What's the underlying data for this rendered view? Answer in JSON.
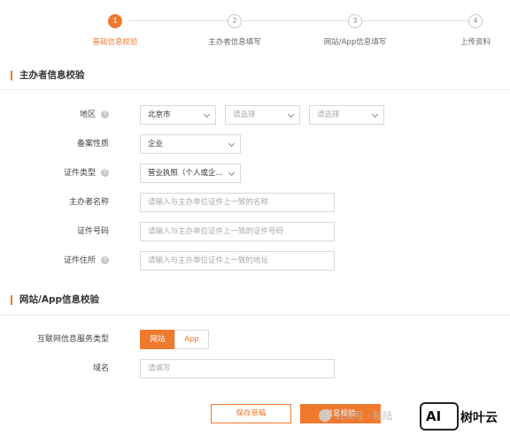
{
  "steps": [
    {
      "num": "1",
      "label": "基础信息校验",
      "active": true
    },
    {
      "num": "2",
      "label": "主办者信息填写",
      "active": false
    },
    {
      "num": "3",
      "label": "网站/App信息填写",
      "active": false
    },
    {
      "num": "4",
      "label": "上传资料",
      "active": false
    }
  ],
  "sponsor_section": {
    "title": "主办者信息校验",
    "region": {
      "label": "地区",
      "city": "北京市",
      "district_placeholder": "请选择",
      "street_placeholder": "请选择"
    },
    "nature": {
      "label": "备案性质",
      "value": "企业"
    },
    "cert_type": {
      "label": "证件类型",
      "value": "营业执照（个人或企..."
    },
    "sponsor_name": {
      "label": "主办者名称",
      "placeholder": "请输入与主办单位证件上一致的名称"
    },
    "cert_number": {
      "label": "证件号码",
      "placeholder": "请输入与主办单位证件上一致的证件号码"
    },
    "cert_address": {
      "label": "证件住所",
      "placeholder": "请输入与主办单位证件上一致的地址"
    }
  },
  "site_section": {
    "title": "网站/App信息校验",
    "service_type": {
      "label": "互联网信息服务类型",
      "options": [
        "网站",
        "App"
      ],
      "selected": "网站"
    },
    "domain": {
      "label": "域名",
      "placeholder": "请填写"
    }
  },
  "actions": {
    "save_draft": "保存草稿",
    "verify": "信息校验"
  },
  "help_glyph": "?",
  "watermark": {
    "text": "公众号 · 陆陆",
    "logo_letters": "AI",
    "logo_name": "树叶云"
  },
  "colors": {
    "accent": "#ef7a2e",
    "border": "#d9d9d9",
    "placeholder": "#aaaaaa"
  }
}
